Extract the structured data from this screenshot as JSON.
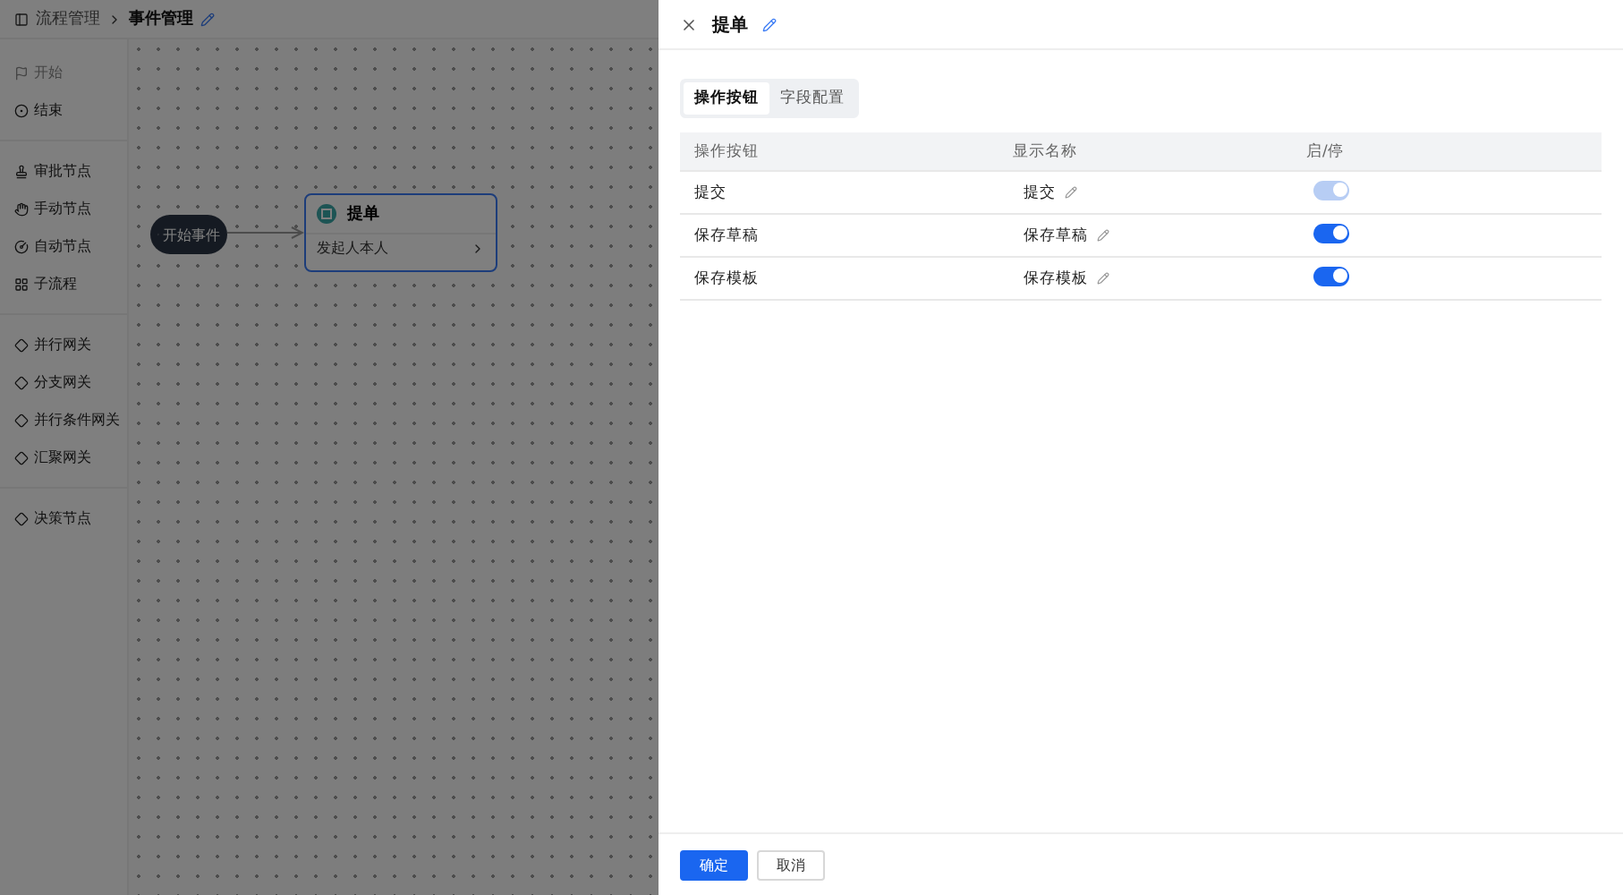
{
  "breadcrumb": {
    "parent": "流程管理",
    "current": "事件管理"
  },
  "sidebar": {
    "groups": [
      {
        "items": [
          {
            "label": "开始",
            "kind": "start",
            "disabled": true
          },
          {
            "label": "结束",
            "kind": "end",
            "disabled": false
          }
        ]
      },
      {
        "items": [
          {
            "label": "审批节点",
            "kind": "approve",
            "disabled": false
          },
          {
            "label": "手动节点",
            "kind": "hand",
            "disabled": false
          },
          {
            "label": "自动节点",
            "kind": "auto",
            "disabled": false
          },
          {
            "label": "子流程",
            "kind": "sub",
            "disabled": false
          }
        ]
      },
      {
        "items": [
          {
            "label": "并行网关",
            "kind": "gateway",
            "disabled": false
          },
          {
            "label": "分支网关",
            "kind": "gateway",
            "disabled": false
          },
          {
            "label": "并行条件网关",
            "kind": "gateway",
            "disabled": false
          },
          {
            "label": "汇聚网关",
            "kind": "gateway",
            "disabled": false
          }
        ]
      },
      {
        "items": [
          {
            "label": "决策节点",
            "kind": "gateway",
            "disabled": false
          }
        ]
      }
    ]
  },
  "canvas": {
    "start_node": {
      "label": "开始事件"
    },
    "task_node": {
      "title": "提单",
      "assignee": "发起人本人",
      "selected": true
    }
  },
  "drawer": {
    "title": "提单",
    "tabs": [
      {
        "label": "操作按钮",
        "selected": true
      },
      {
        "label": "字段配置",
        "selected": false
      }
    ],
    "columns": [
      "操作按钮",
      "显示名称",
      "启/停"
    ],
    "rows": [
      {
        "name": "提交",
        "display": "提交",
        "on": true,
        "disabled": true
      },
      {
        "name": "保存草稿",
        "display": "保存草稿",
        "on": true,
        "disabled": false
      },
      {
        "name": "保存模板",
        "display": "保存模板",
        "on": true,
        "disabled": false
      }
    ],
    "buttons": [
      {
        "label": "确定",
        "kind": "primary"
      },
      {
        "label": "取消",
        "kind": "default"
      }
    ]
  }
}
